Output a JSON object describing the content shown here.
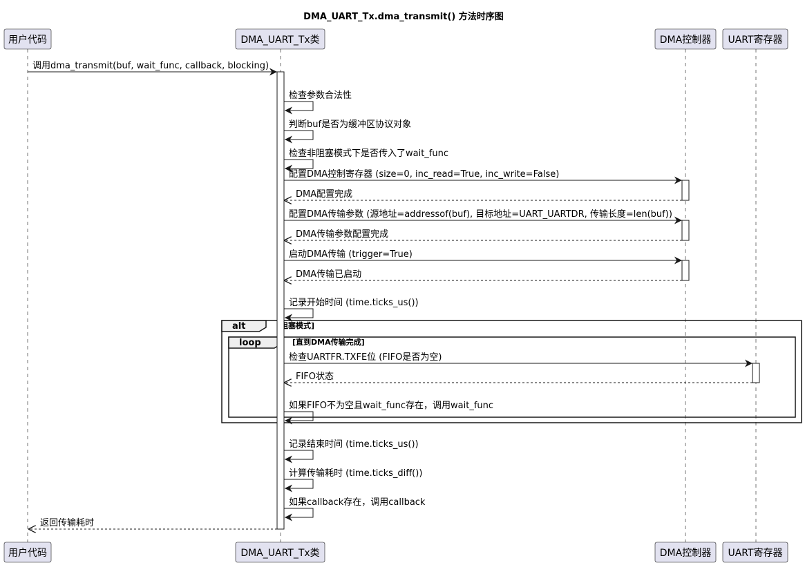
{
  "title": "DMA_UART_Tx.dma_transmit() 方法时序图",
  "colors": {
    "participant_fill": "#E2E2F0",
    "participant_stroke": "#181818",
    "activation_fill": "#FFFFFF",
    "fragment_header_fill": "#EEEEEE",
    "line": "#181818"
  },
  "participants": [
    {
      "id": "user",
      "label": "用户代码"
    },
    {
      "id": "dma_cls",
      "label": "DMA_UART_Tx类"
    },
    {
      "id": "dmac",
      "label": "DMA控制器"
    },
    {
      "id": "uart",
      "label": "UART寄存器"
    }
  ],
  "messages": [
    {
      "from": "user",
      "to": "dma_cls",
      "kind": "sync",
      "text": "调用dma_transmit(buf, wait_func, callback, blocking)"
    },
    {
      "from": "dma_cls",
      "to": "dma_cls",
      "kind": "self",
      "text": "检查参数合法性"
    },
    {
      "from": "dma_cls",
      "to": "dma_cls",
      "kind": "self",
      "text": "判断buf是否为缓冲区协议对象"
    },
    {
      "from": "dma_cls",
      "to": "dma_cls",
      "kind": "self",
      "text": "检查非阻塞模式下是否传入了wait_func"
    },
    {
      "from": "dma_cls",
      "to": "dmac",
      "kind": "sync",
      "text": "配置DMA控制寄存器 (size=0, inc_read=True, inc_write=False)"
    },
    {
      "from": "dmac",
      "to": "dma_cls",
      "kind": "return",
      "text": "DMA配置完成"
    },
    {
      "from": "dma_cls",
      "to": "dmac",
      "kind": "sync",
      "text": "配置DMA传输参数 (源地址=addressof(buf), 目标地址=UART_UARTDR, 传输长度=len(buf))"
    },
    {
      "from": "dmac",
      "to": "dma_cls",
      "kind": "return",
      "text": "DMA传输参数配置完成"
    },
    {
      "from": "dma_cls",
      "to": "dmac",
      "kind": "sync",
      "text": "启动DMA传输 (trigger=True)"
    },
    {
      "from": "dmac",
      "to": "dma_cls",
      "kind": "return",
      "text": "DMA传输已启动"
    },
    {
      "from": "dma_cls",
      "to": "dma_cls",
      "kind": "self",
      "text": "记录开始时间 (time.ticks_us())"
    },
    {
      "from": "dma_cls",
      "to": "uart",
      "kind": "sync",
      "text": "检查UARTFR.TXFE位 (FIFO是否为空)"
    },
    {
      "from": "uart",
      "to": "dma_cls",
      "kind": "return",
      "text": "FIFO状态"
    },
    {
      "from": "dma_cls",
      "to": "dma_cls",
      "kind": "self",
      "text": "如果FIFO不为空且wait_func存在，调用wait_func"
    },
    {
      "from": "dma_cls",
      "to": "dma_cls",
      "kind": "self",
      "text": "记录结束时间 (time.ticks_us())"
    },
    {
      "from": "dma_cls",
      "to": "dma_cls",
      "kind": "self",
      "text": "计算传输耗时 (time.ticks_diff())"
    },
    {
      "from": "dma_cls",
      "to": "dma_cls",
      "kind": "self",
      "text": "如果callback存在，调用callback"
    },
    {
      "from": "dma_cls",
      "to": "user",
      "kind": "return",
      "text": "返回传输耗时"
    }
  ],
  "fragments": [
    {
      "keyword": "alt",
      "condition": "[阻塞模式]"
    },
    {
      "keyword": "loop",
      "condition": "[直到DMA传输完成]"
    }
  ]
}
